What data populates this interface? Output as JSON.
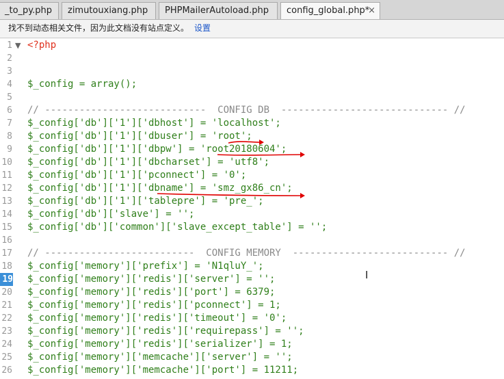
{
  "tabs": [
    {
      "label": "_to_py.php",
      "active": false
    },
    {
      "label": "zimutouxiang.php",
      "active": false
    },
    {
      "label": "PHPMailerAutoload.php",
      "active": false
    },
    {
      "label": "config_global.php*",
      "active": true
    }
  ],
  "tab_close_symbol": "×",
  "infobar": {
    "icon": "i",
    "message": "找不到动态相关文件，因为此文档没有站点定义。",
    "link": "设置"
  },
  "editor": {
    "current_line": 19,
    "fold_marker": "▼",
    "annotation_color": "#e00000",
    "line_numbers": [
      "1",
      "2",
      "3",
      "4",
      "5",
      "6",
      "7",
      "8",
      "9",
      "10",
      "11",
      "12",
      "13",
      "14",
      "15",
      "16",
      "17",
      "18",
      "19",
      "20",
      "21",
      "22",
      "23",
      "24",
      "25",
      "26"
    ],
    "lines": [
      "<?php",
      "",
      "",
      "$_config = array();",
      "",
      "// ----------------------------  CONFIG DB  ----------------------------- //",
      "$_config['db']['1']['dbhost'] = 'localhost';",
      "$_config['db']['1']['dbuser'] = 'root';",
      "$_config['db']['1']['dbpw'] = 'root20180604';",
      "$_config['db']['1']['dbcharset'] = 'utf8';",
      "$_config['db']['1']['pconnect'] = '0';",
      "$_config['db']['1']['dbname'] = 'smz_gx86_cn';",
      "$_config['db']['1']['tablepre'] = 'pre_';",
      "$_config['db']['slave'] = '';",
      "$_config['db']['common']['slave_except_table'] = '';",
      "",
      "// --------------------------  CONFIG MEMORY  --------------------------- //",
      "$_config['memory']['prefix'] = 'N1qluY_';",
      "$_config['memory']['redis']['server'] = '';",
      "$_config['memory']['redis']['port'] = 6379;",
      "$_config['memory']['redis']['pconnect'] = 1;",
      "$_config['memory']['redis']['timeout'] = '0';",
      "$_config['memory']['redis']['requirepass'] = '';",
      "$_config['memory']['redis']['serializer'] = 1;",
      "$_config['memory']['memcache']['server'] = '';",
      "$_config['memory']['memcache']['port'] = 11211;"
    ]
  }
}
